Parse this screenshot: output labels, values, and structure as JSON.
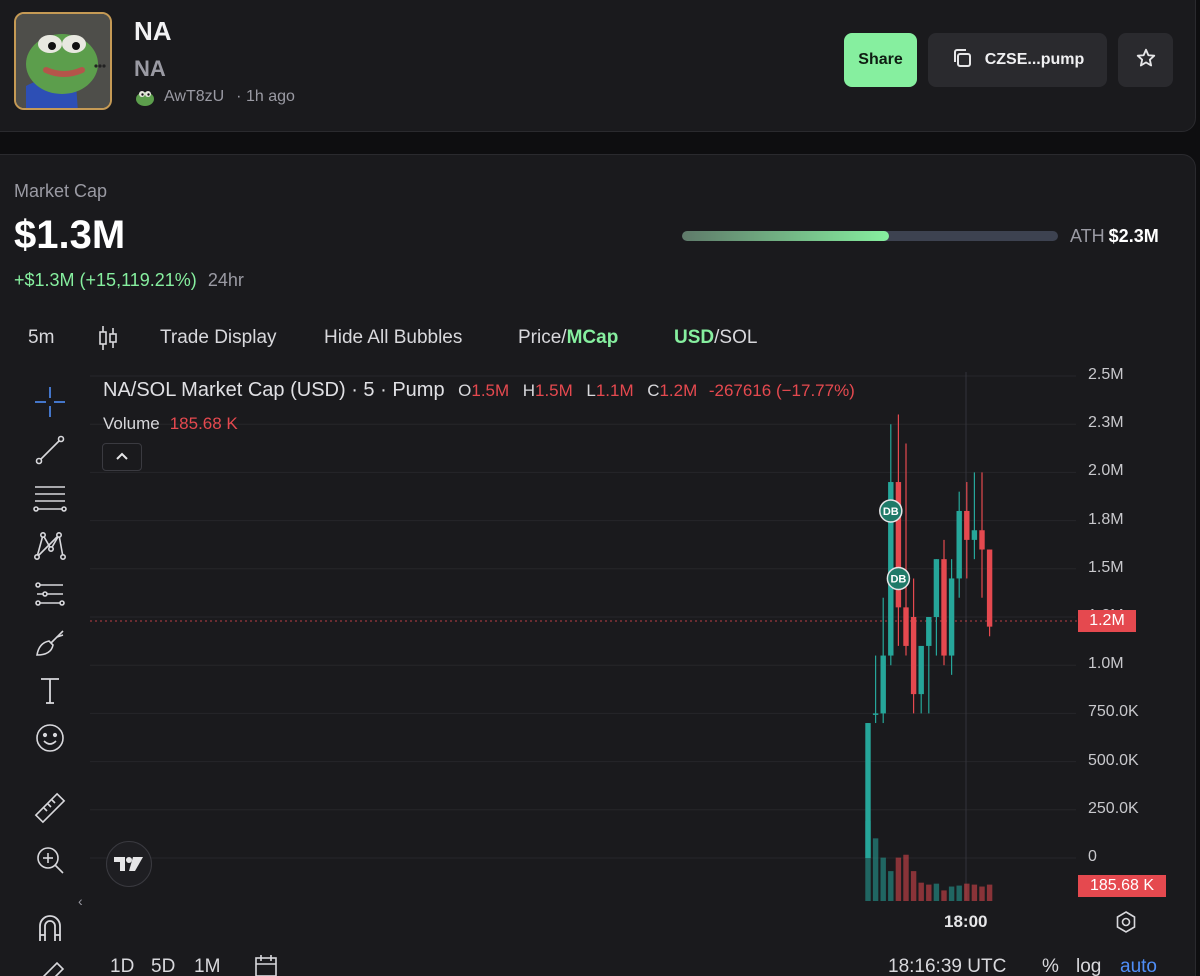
{
  "token": {
    "name": "NA",
    "ticker": "NA",
    "creator": "AwT8zU",
    "age": "· 1h ago"
  },
  "header": {
    "share_label": "Share",
    "ca_label": "CZSE...pump"
  },
  "market": {
    "label": "Market Cap",
    "value": "$1.3M",
    "change": "+$1.3M (+15,119.21%)",
    "period": "24hr",
    "ath_label": "ATH",
    "ath_value": "$2.3M",
    "ath_progress": 0.55
  },
  "toolbar": {
    "interval": "5m",
    "trade_display": "Trade Display",
    "hide_bubbles": "Hide All Bubbles",
    "price_label": "Price/",
    "mcap_label": "MCap",
    "usd_label": "USD",
    "sol_label": "/SOL"
  },
  "legend": {
    "title": "NA/SOL Market Cap (USD) · 5 · Pump",
    "o_key": "O",
    "o_val": "1.5M",
    "h_key": "H",
    "h_val": "1.5M",
    "l_key": "L",
    "l_val": "1.1M",
    "c_key": "C",
    "c_val": "1.2M",
    "change": "-267616 (−17.77%)",
    "volume_label": "Volume",
    "volume_value": "185.68 K"
  },
  "axis": {
    "current_price_tag": "1.2M",
    "volume_tag": "185.68 K",
    "time_label": "18:00",
    "bubble_label": "DB"
  },
  "bottom": {
    "range_1d": "1D",
    "range_5d": "5D",
    "range_1m": "1M",
    "clock": "18:16:39 UTC",
    "pct": "%",
    "log": "log",
    "auto": "auto"
  },
  "colors": {
    "up": "#26a69a",
    "down": "#e5494f",
    "accent": "#86ef9f"
  },
  "chart_data": {
    "type": "candlestick",
    "ylabels": [
      "2.5M",
      "2.3M",
      "2.0M",
      "1.8M",
      "1.5M",
      "1.2M",
      "1.0M",
      "750.0K",
      "500.0K",
      "250.0K",
      "0"
    ],
    "ylim": [
      0,
      2500000
    ],
    "candles": [
      {
        "o": 0,
        "h": 700000,
        "l": 0,
        "c": 700000
      },
      {
        "o": 750000,
        "h": 1050000,
        "l": 700000,
        "c": 750000
      },
      {
        "o": 750000,
        "h": 1350000,
        "l": 700000,
        "c": 1050000
      },
      {
        "o": 1050000,
        "h": 2250000,
        "l": 1000000,
        "c": 1950000
      },
      {
        "o": 1950000,
        "h": 2300000,
        "l": 1100000,
        "c": 1300000
      },
      {
        "o": 1300000,
        "h": 2150000,
        "l": 1050000,
        "c": 1100000
      },
      {
        "o": 1250000,
        "h": 1450000,
        "l": 750000,
        "c": 850000
      },
      {
        "o": 850000,
        "h": 1050000,
        "l": 750000,
        "c": 1100000
      },
      {
        "o": 1100000,
        "h": 1200000,
        "l": 750000,
        "c": 1250000
      },
      {
        "o": 1250000,
        "h": 1550000,
        "l": 1050000,
        "c": 1550000
      },
      {
        "o": 1550000,
        "h": 1650000,
        "l": 1000000,
        "c": 1050000
      },
      {
        "o": 1050000,
        "h": 1550000,
        "l": 950000,
        "c": 1450000
      },
      {
        "o": 1450000,
        "h": 1900000,
        "l": 1350000,
        "c": 1800000
      },
      {
        "o": 1800000,
        "h": 1950000,
        "l": 1450000,
        "c": 1650000
      },
      {
        "o": 1650000,
        "h": 2000000,
        "l": 1550000,
        "c": 1700000
      },
      {
        "o": 1700000,
        "h": 2000000,
        "l": 1350000,
        "c": 1600000
      },
      {
        "o": 1600000,
        "h": 1600000,
        "l": 1150000,
        "c": 1200000
      }
    ],
    "volumes": [
      830000,
      650000,
      450000,
      310000,
      450000,
      480000,
      310000,
      190000,
      170000,
      180000,
      110000,
      150000,
      160000,
      180000,
      170000,
      150000,
      170000
    ],
    "vol_dir": [
      "up",
      "up",
      "up",
      "up",
      "down",
      "down",
      "down",
      "down",
      "down",
      "up",
      "down",
      "up",
      "up",
      "down",
      "down",
      "down",
      "down"
    ],
    "bubbles": [
      {
        "candle": 3,
        "value": 1800000
      },
      {
        "candle": 4,
        "value": 1450000
      }
    ]
  }
}
